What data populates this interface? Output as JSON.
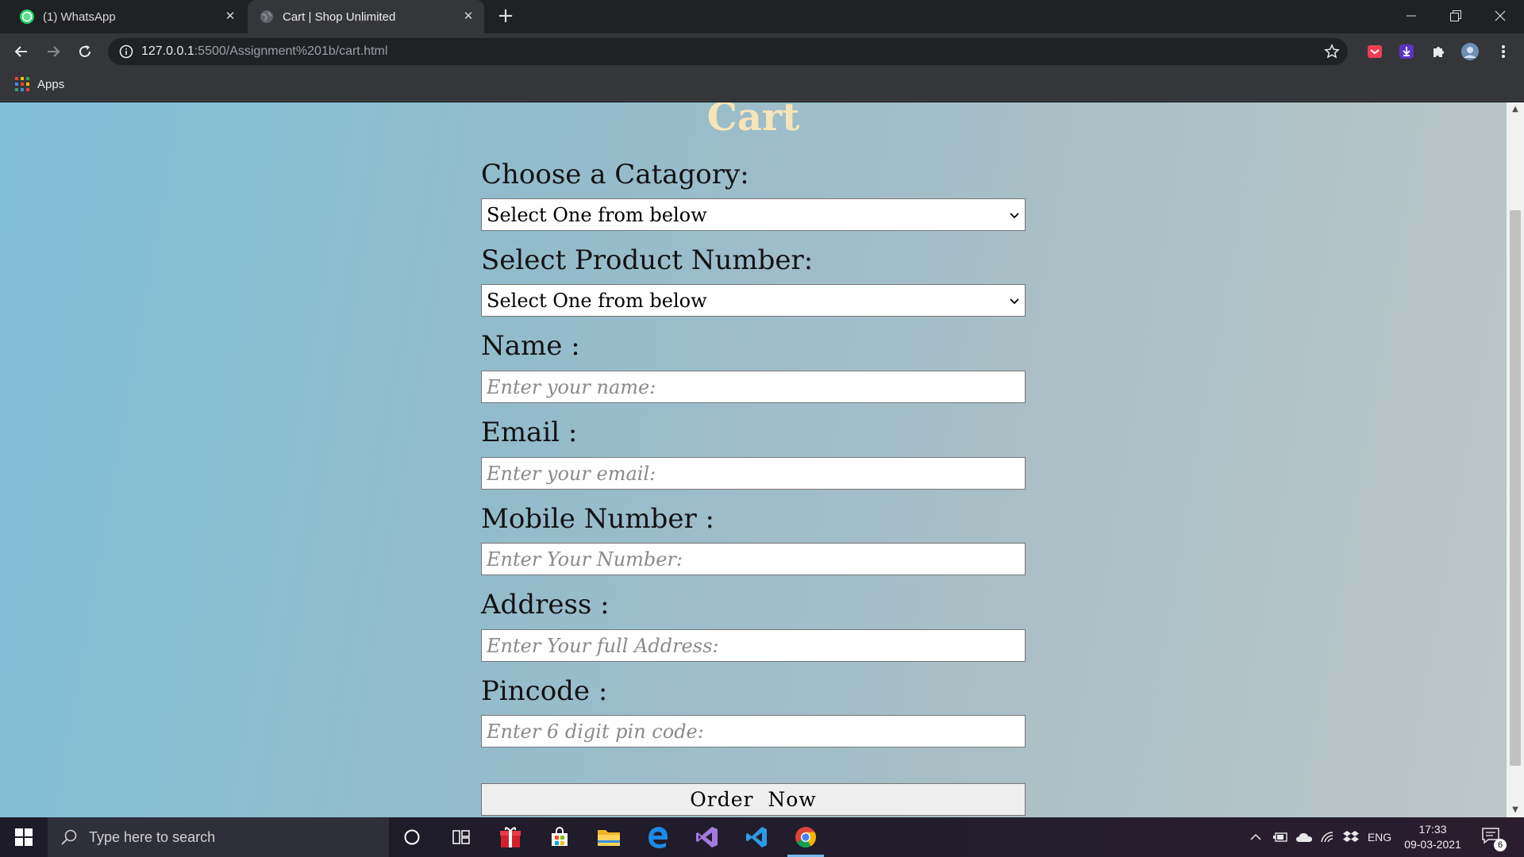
{
  "browser": {
    "tabs": [
      {
        "title": "(1) WhatsApp",
        "icon": "whatsapp-icon"
      },
      {
        "title": "Cart | Shop Unlimited",
        "icon": "globe-icon"
      }
    ],
    "url_host": "127.0.0.1",
    "url_path": ":5500/Assignment%201b/cart.html",
    "bookmarks": {
      "apps_label": "Apps"
    }
  },
  "page": {
    "title": "Cart",
    "category_label": "Choose a Catagory:",
    "category_value": "Select One from below",
    "product_label": "Select Product Number:",
    "product_value": "Select One from below",
    "name_label": "Name :",
    "name_placeholder": "Enter your name:",
    "email_label": "Email :",
    "email_placeholder": "Enter your email:",
    "mobile_label": "Mobile Number :",
    "mobile_placeholder": "Enter Your Number:",
    "address_label": "Address :",
    "address_placeholder": "Enter Your full Address:",
    "pincode_label": "Pincode :",
    "pincode_placeholder": "Enter 6 digit pin code:",
    "submit_label": "Order  Now",
    "colors": {
      "title": "#f7e4b8",
      "background_left": "#7fbfd8",
      "background_right": "#bcc6c8"
    }
  },
  "taskbar": {
    "search_placeholder": "Type here to search",
    "language": "ENG",
    "time": "17:33",
    "date": "09-03-2021",
    "notification_count": "6"
  }
}
